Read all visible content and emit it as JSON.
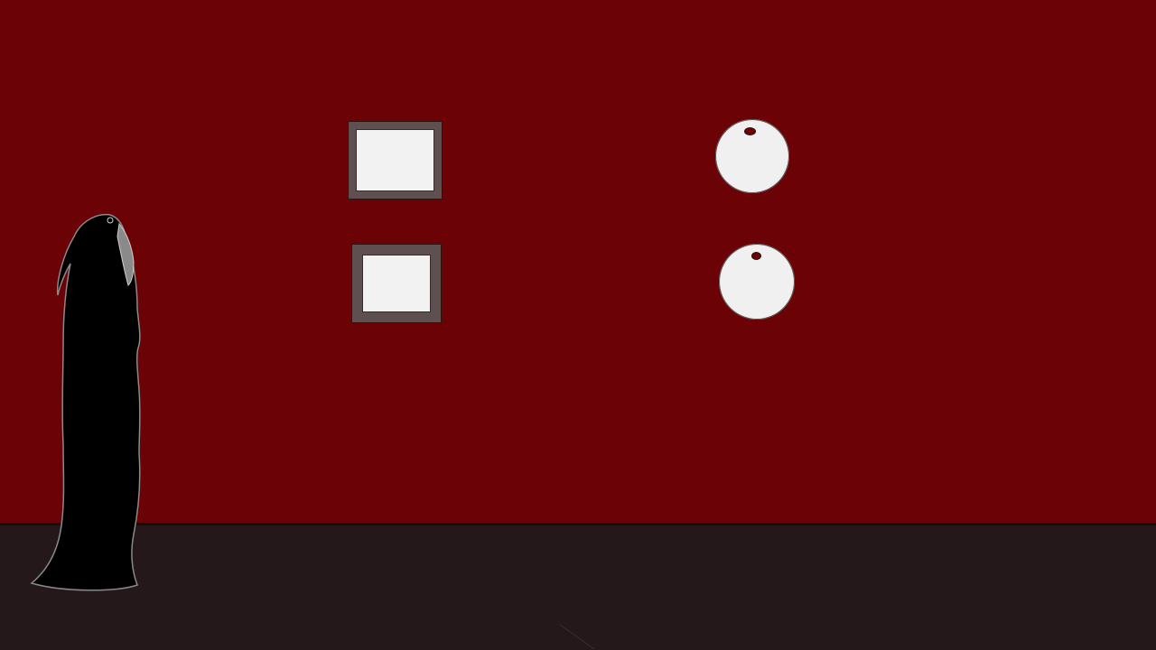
{
  "scene": {
    "colors": {
      "wall": "#6b0205",
      "floor": "#24181a",
      "frame_border": "#5e4f50",
      "canvas": "#f2f2f2",
      "orb": "#f0f0f0",
      "orb_hole": "#6b0205",
      "figure": "#000000",
      "figure_highlight": "#8a8a8a"
    },
    "objects": {
      "frame_top": "picture-frame",
      "frame_bottom": "picture-frame",
      "orb_top": "wall-orb",
      "orb_bottom": "wall-orb",
      "figure": "cloaked-figure"
    }
  }
}
